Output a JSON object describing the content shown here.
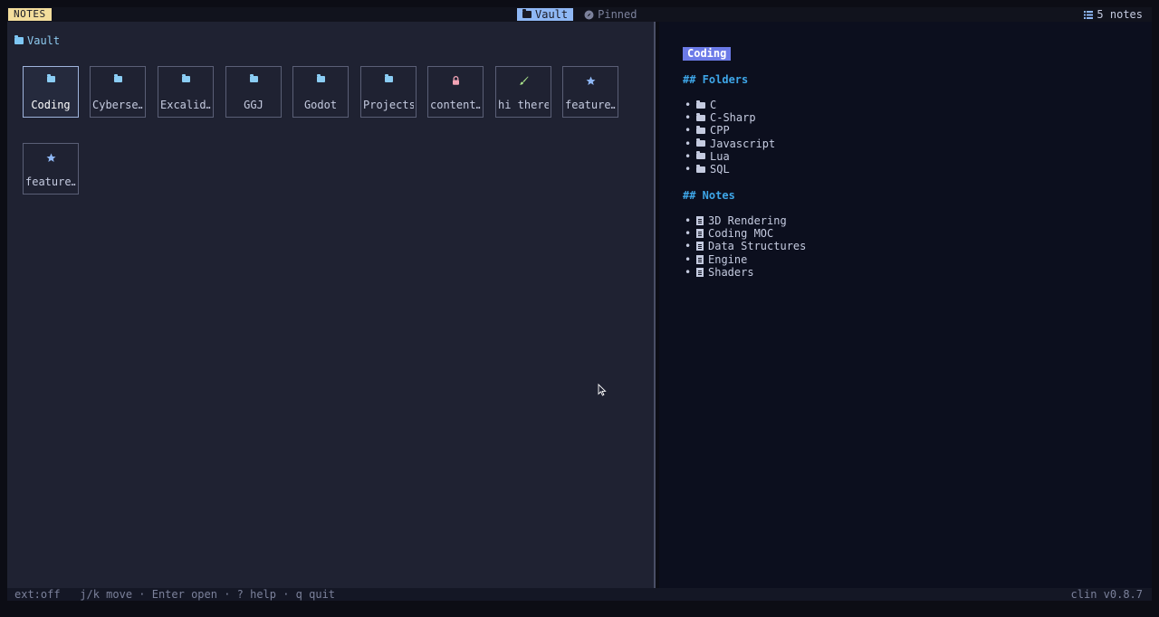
{
  "app": {
    "badge": "NOTES",
    "version": "clin v0.8.7"
  },
  "header": {
    "tabs": [
      {
        "label": "Vault",
        "active": true
      },
      {
        "label": "Pinned",
        "active": false
      }
    ],
    "notes_count": "5 notes"
  },
  "left": {
    "breadcrumb": "Vault",
    "tiles": [
      {
        "label": "Coding",
        "icon": "folder-icon",
        "selected": true
      },
      {
        "label": "Cyberse…",
        "icon": "folder-icon"
      },
      {
        "label": "Excalid…",
        "icon": "folder-icon"
      },
      {
        "label": "GGJ",
        "icon": "folder-icon"
      },
      {
        "label": "Godot",
        "icon": "folder-icon"
      },
      {
        "label": "Projects",
        "icon": "folder-icon"
      },
      {
        "label": "content…",
        "icon": "lock-icon"
      },
      {
        "label": "hi there",
        "icon": "brush-icon"
      },
      {
        "label": "feature…",
        "icon": "star-icon"
      },
      {
        "label": "feature…",
        "icon": "star-icon"
      }
    ]
  },
  "preview": {
    "title": "Coding",
    "folders_heading": "## Folders",
    "folders": [
      "C",
      "C-Sharp",
      "CPP",
      "Javascript",
      "Lua",
      "SQL"
    ],
    "notes_heading": "## Notes",
    "notes": [
      "3D Rendering",
      "Coding MOC",
      "Data Structures",
      "Engine",
      "Shaders"
    ]
  },
  "footer": {
    "ext_status": "ext:off",
    "hints": "j/k move · Enter open · ? help · q quit"
  },
  "colors": {
    "accent": "#8fb8f5",
    "badge": "#f3dd9c",
    "title_badge": "#6c7be8",
    "heading": "#3ea6e8"
  }
}
